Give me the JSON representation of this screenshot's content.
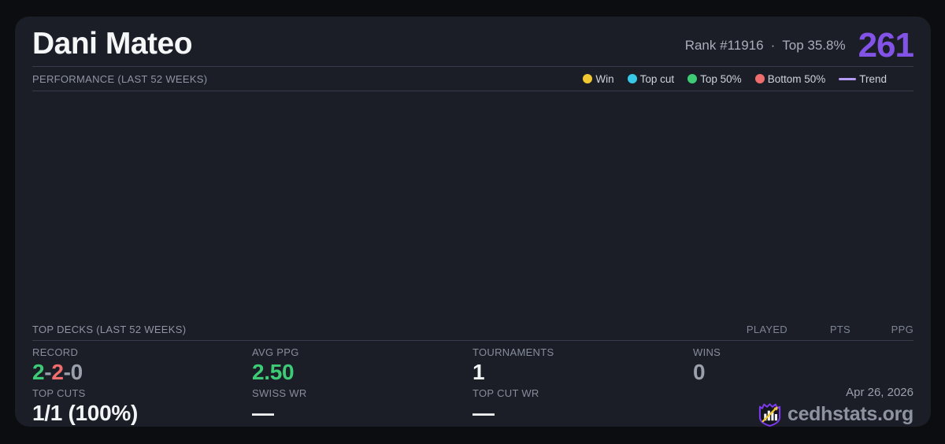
{
  "colors": {
    "page_bg": "#0c0d10",
    "card_bg": "#1b1e27",
    "divider": "#363c4c",
    "accent_purple": "#8353e8",
    "trend_purple": "#b49cf6",
    "win_yellow": "#f2c832",
    "topcut_cyan": "#38c8e8",
    "top50_green": "#3dcb76",
    "bottom50_red": "#ef6d6d",
    "white": "#f2f3f5",
    "muted_grey": "#9aa0ab"
  },
  "header": {
    "player_name": "Dani Mateo",
    "rank_label": "Rank #11916",
    "separator": "·",
    "top_percent": "Top 35.8%",
    "rating": "261"
  },
  "performance": {
    "title": "PERFORMANCE (LAST 52 WEEKS)",
    "legend": [
      {
        "label": "Win",
        "marker": "dot",
        "color": "#f2c832"
      },
      {
        "label": "Top cut",
        "marker": "dot",
        "color": "#38c8e8"
      },
      {
        "label": "Top 50%",
        "marker": "dot",
        "color": "#3dcb76"
      },
      {
        "label": "Bottom 50%",
        "marker": "dot",
        "color": "#ef6d6d"
      },
      {
        "label": "Trend",
        "marker": "line",
        "color": "#b49cf6"
      }
    ]
  },
  "chart_data": {
    "type": "scatter",
    "title": "PERFORMANCE (LAST 52 WEEKS)",
    "x": [],
    "series": [],
    "grid": false,
    "empty": true
  },
  "top_decks": {
    "title": "TOP DECKS (LAST 52 WEEKS)",
    "columns": [
      "PLAYED",
      "PTS",
      "PPG"
    ],
    "rows": []
  },
  "stats": {
    "record": {
      "label": "RECORD",
      "parts": [
        {
          "t": "2",
          "c": "#3dcb76"
        },
        {
          "t": "-",
          "c": "#9aa0ab"
        },
        {
          "t": "2",
          "c": "#ef6d6d"
        },
        {
          "t": "-",
          "c": "#9aa0ab"
        },
        {
          "t": "0",
          "c": "#9aa0ab"
        }
      ]
    },
    "avg_ppg": {
      "label": "AVG PPG",
      "value": "2.50",
      "color": "#3dcb76"
    },
    "tournaments": {
      "label": "TOURNAMENTS",
      "value": "1",
      "color": "#f2f3f5"
    },
    "wins": {
      "label": "WINS",
      "value": "0",
      "color": "#9aa0ab"
    },
    "top_cuts": {
      "label": "TOP CUTS",
      "value": "1/1 (100%)",
      "color": "#f2f3f5"
    },
    "swiss_wr": {
      "label": "SWISS WR",
      "value": "—",
      "color": "#f2f3f5"
    },
    "top_cut_wr": {
      "label": "TOP CUT WR",
      "value": "—",
      "color": "#f2f3f5"
    }
  },
  "footer": {
    "date": "Apr 26, 2026",
    "brand": "cedhstats.org",
    "logo": "cedhstats-shield-logo"
  }
}
